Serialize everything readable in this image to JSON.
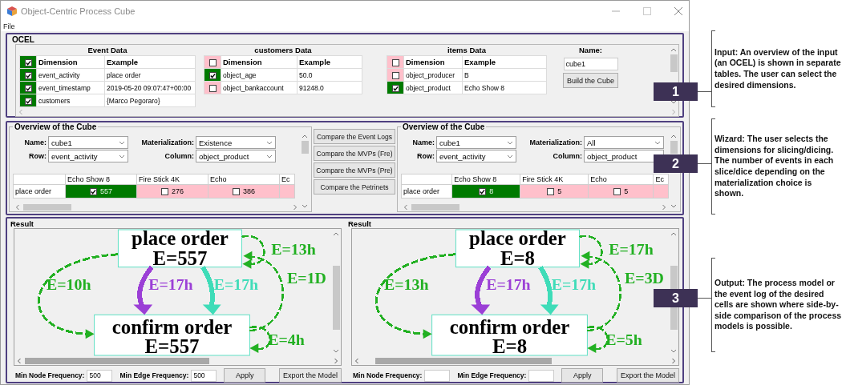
{
  "window": {
    "title": "Object-Centric Process Cube"
  },
  "menu": [
    {
      "label": "File"
    }
  ],
  "input": {
    "label": "OCEL",
    "tables": [
      {
        "title": "Event Data",
        "header_checked": true,
        "headers": [
          "Dimension",
          "Example"
        ],
        "rows": [
          {
            "checked": true,
            "dimension": "event_activity",
            "example": "place order"
          },
          {
            "checked": true,
            "dimension": "event_timestamp",
            "example": "2019-05-20 09:07:47+00:00"
          },
          {
            "checked": true,
            "dimension": "customers",
            "example": "{Marco Pegoraro}"
          }
        ]
      },
      {
        "title": "customers Data",
        "header_checked": false,
        "headers": [
          "Dimension",
          "Example"
        ],
        "rows": [
          {
            "checked": true,
            "dimension": "object_age",
            "example": "50.0"
          },
          {
            "checked": false,
            "dimension": "object_bankaccount",
            "example": "91248.0"
          }
        ]
      },
      {
        "title": "items Data",
        "header_checked": false,
        "headers": [
          "Dimension",
          "Example"
        ],
        "rows": [
          {
            "checked": false,
            "dimension": "object_producer",
            "example": "B"
          },
          {
            "checked": true,
            "dimension": "object_product",
            "example": "Echo Show 8"
          }
        ]
      }
    ],
    "name_label": "Name:",
    "name_value": "cube1",
    "build_button": "Build the Cube"
  },
  "wizard": {
    "cubes": [
      {
        "title": "Overview of the Cube",
        "fields": [
          {
            "label": "Name:",
            "value": "cube1"
          },
          {
            "label": "Materialization:",
            "value": "Existence"
          },
          {
            "label": "Row:",
            "value": "event_activity"
          },
          {
            "label": "Column:",
            "value": "object_product"
          }
        ],
        "columns": [
          "Echo Show 8",
          "Fire Stick 4K",
          "Echo",
          "Ec"
        ],
        "rows": [
          {
            "label": "place order",
            "cells": [
              {
                "checked": true,
                "value": "557"
              },
              {
                "checked": false,
                "value": "276"
              },
              {
                "checked": false,
                "value": "386"
              }
            ]
          }
        ]
      },
      {
        "title": "Overview of the Cube",
        "fields": [
          {
            "label": "Name:",
            "value": "cube1"
          },
          {
            "label": "Materialization:",
            "value": "All"
          },
          {
            "label": "Row:",
            "value": "event_activity"
          },
          {
            "label": "Column:",
            "value": "object_product"
          }
        ],
        "columns": [
          "Echo Show 8",
          "Fire Stick 4K",
          "Echo",
          "Ec"
        ],
        "rows": [
          {
            "label": "place order",
            "cells": [
              {
                "checked": true,
                "value": "8"
              },
              {
                "checked": false,
                "value": "5"
              },
              {
                "checked": false,
                "value": "5"
              }
            ]
          }
        ]
      }
    ],
    "compare_buttons": [
      "Compare the Event Logs",
      "Compare the MVPs (Fre)",
      "Compare the MVPs (Pre)",
      "Compare the Petrinets"
    ]
  },
  "results": [
    {
      "title": "Result",
      "graph": {
        "nodes": [
          {
            "label": "place order",
            "frequency": "E=557"
          },
          {
            "label": "confirm order",
            "frequency": "E=557"
          }
        ],
        "edges": [
          {
            "kind": "self_top",
            "label": "E=13h",
            "color": "#22b022"
          },
          {
            "kind": "arc_left",
            "label": "E=10h",
            "color": "#22b022"
          },
          {
            "kind": "straight_left",
            "label": "E=17h",
            "color": "#9b3fd6"
          },
          {
            "kind": "straight_right",
            "label": "E=17h",
            "color": "#3fdcb8"
          },
          {
            "kind": "arc_right",
            "label": "E=1D",
            "color": "#22b022"
          },
          {
            "kind": "self_bottom",
            "label": "E=4h",
            "color": "#22b022"
          }
        ]
      },
      "controls": {
        "min_node_label": "Min Node Frequency:",
        "min_node": "500",
        "min_edge_label": "Min Edge Frequency:",
        "min_edge": "500",
        "apply": "Apply",
        "export": "Export the Model"
      }
    },
    {
      "title": "Result",
      "graph": {
        "nodes": [
          {
            "label": "place order",
            "frequency": "E=8"
          },
          {
            "label": "confirm order",
            "frequency": "E=8"
          }
        ],
        "edges": [
          {
            "kind": "self_top",
            "label": "E=17h",
            "color": "#22b022"
          },
          {
            "kind": "arc_left",
            "label": "E=13h",
            "color": "#22b022"
          },
          {
            "kind": "straight_left",
            "label": "E=17h",
            "color": "#9b3fd6"
          },
          {
            "kind": "straight_right",
            "label": "E=17h",
            "color": "#3fdcb8"
          },
          {
            "kind": "arc_right",
            "label": "E=3D",
            "color": "#22b022"
          },
          {
            "kind": "self_bottom",
            "label": "E=5h",
            "color": "#22b022"
          }
        ]
      },
      "controls": {
        "min_node_label": "Min Node Frequency:",
        "min_edge_label": "Min Edge Frequency:",
        "apply": "Apply",
        "export": "Export the Model"
      }
    }
  ],
  "annotations": [
    {
      "number": "1",
      "text": "Input: An overview of the input (an OCEL) is shown in separate tables. The user can select the desired dimensions."
    },
    {
      "number": "2",
      "text": "Wizard: The user selects the dimensions for slicing/dicing. The number of events in each slice/dice depending on the materialization choice is shown."
    },
    {
      "number": "3",
      "text": "Output: The process model or the event log of the desired cells are shown where side-by-side comparison of the process models is possible."
    }
  ]
}
